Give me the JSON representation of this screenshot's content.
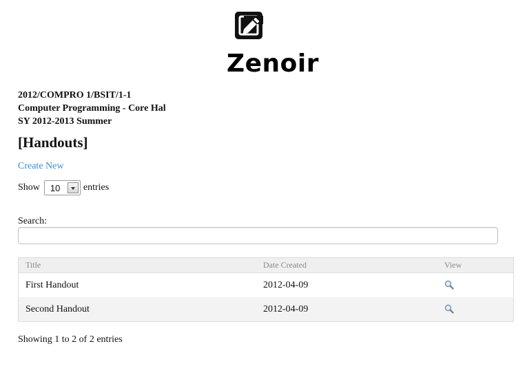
{
  "app": {
    "brand": "Zenoir",
    "logo_icon": "edit-square-icon"
  },
  "course": {
    "code": "2012/COMPRO 1/BSIT/1-1",
    "name": "Computer Programming - Core Hal",
    "term": "SY 2012-2013 Summer"
  },
  "section_title": "[Handouts]",
  "actions": {
    "create_new": "Create New"
  },
  "length_menu": {
    "prefix": "Show",
    "selected": "10",
    "suffix": "entries"
  },
  "search": {
    "label": "Search:",
    "value": "",
    "placeholder": ""
  },
  "table": {
    "columns": [
      "Title",
      "Date Created",
      "View"
    ],
    "rows": [
      {
        "title": "First Handout",
        "date_created": "2012-04-09",
        "view_icon": "magnifier-icon"
      },
      {
        "title": "Second Handout",
        "date_created": "2012-04-09",
        "view_icon": "magnifier-icon"
      }
    ]
  },
  "info": "Showing 1 to 2 of 2 entries",
  "colors": {
    "link": "#3a8ecf",
    "header_bg": "#efefef",
    "stripe_bg": "#f3f3f3"
  }
}
